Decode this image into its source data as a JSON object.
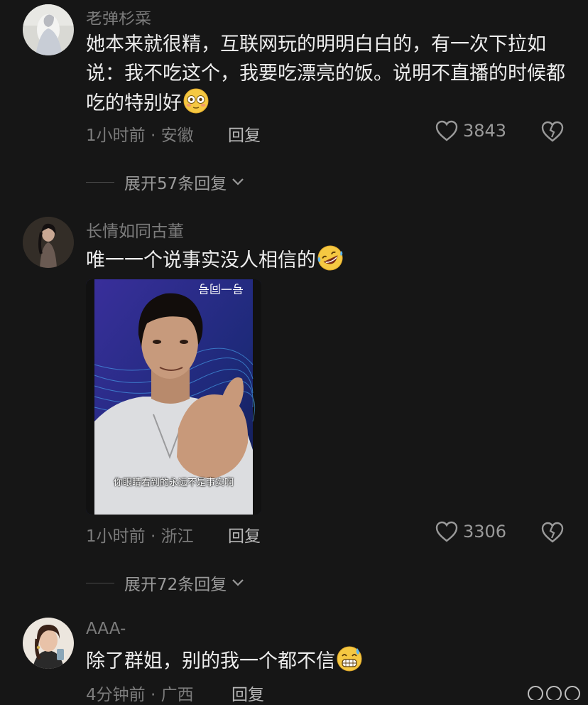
{
  "comments": [
    {
      "username": "老弹杉菜",
      "text": "她本来就很精，互联网玩的明明白白的，有一次下拉如说：我不吃这个，我要吃漂亮的饭。说明不直播的时候都吃的特别好",
      "emoji": "flushed-face",
      "time": "1小时前",
      "location": "安徽",
      "reply_label": "回复",
      "likes": "3843",
      "expand_label": "展开57条回复"
    },
    {
      "username": "长情如同古董",
      "text": "唯一一个说事实没人相信的",
      "emoji": "rolling-laughing-face",
      "video": {
        "subtitle": "你眼睛看到的永远不是事实啊",
        "background_text": "号一同号"
      },
      "time": "1小时前",
      "location": "浙江",
      "reply_label": "回复",
      "likes": "3306",
      "expand_label": "展开72条回复"
    },
    {
      "username": "AAA-",
      "text": "除了群姐，别的我一个都不信",
      "emoji": "grinning-sweat-face",
      "time": "4分钟前",
      "location": "广西",
      "reply_label": "回复"
    }
  ],
  "separator": " · ",
  "colors": {
    "background": "#161616",
    "primary_text": "#ededed",
    "secondary_text": "#7c7c7c",
    "icon": "#9a9a9a"
  }
}
